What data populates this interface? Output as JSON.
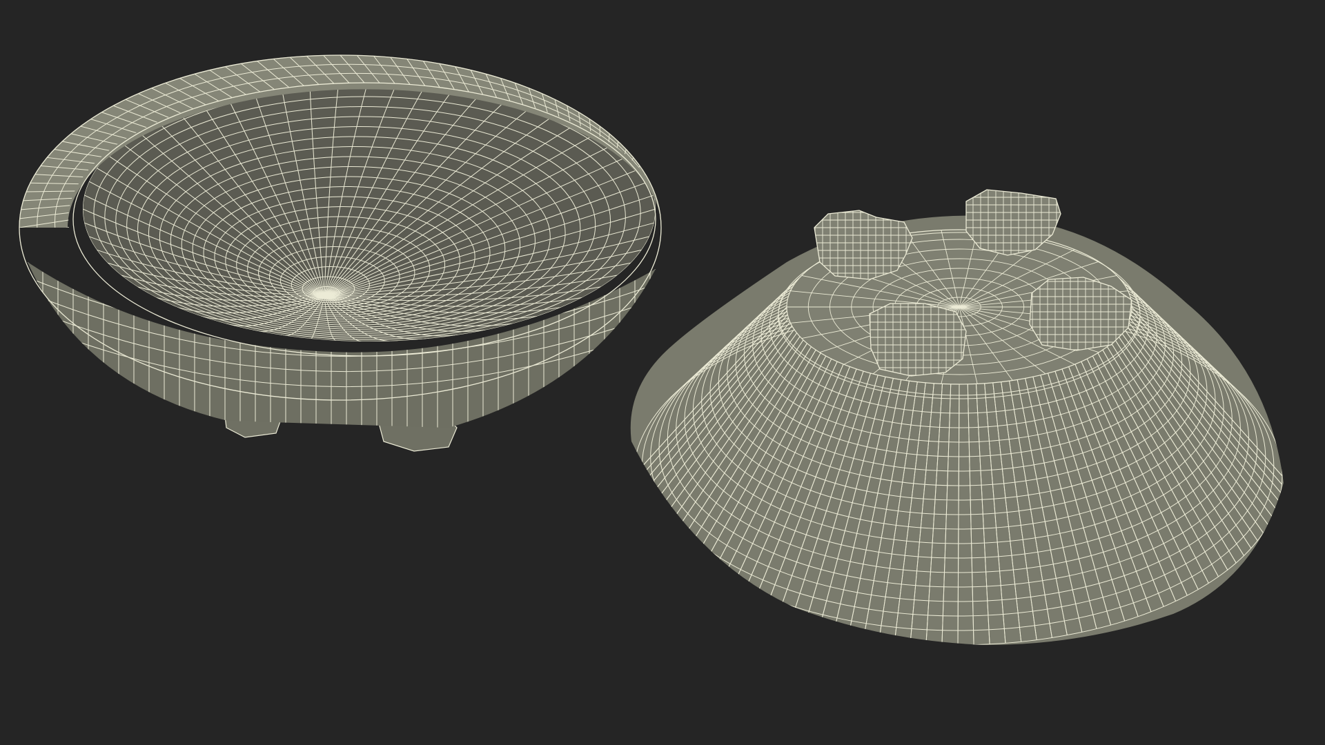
{
  "viewport": {
    "background": "#252525",
    "mode": "wireframe-on-shaded"
  },
  "palette": {
    "surface_outer": "#7b7c6e",
    "surface_inner": "#5f5f55",
    "surface_dark": "#4e4e46",
    "rim": "#8a8b7c",
    "wire": "#ecebd6"
  },
  "objects": [
    {
      "kind": "bowl",
      "orientation": "upright",
      "feet": 4
    },
    {
      "kind": "bowl",
      "orientation": "upside-down",
      "feet": 4
    }
  ]
}
